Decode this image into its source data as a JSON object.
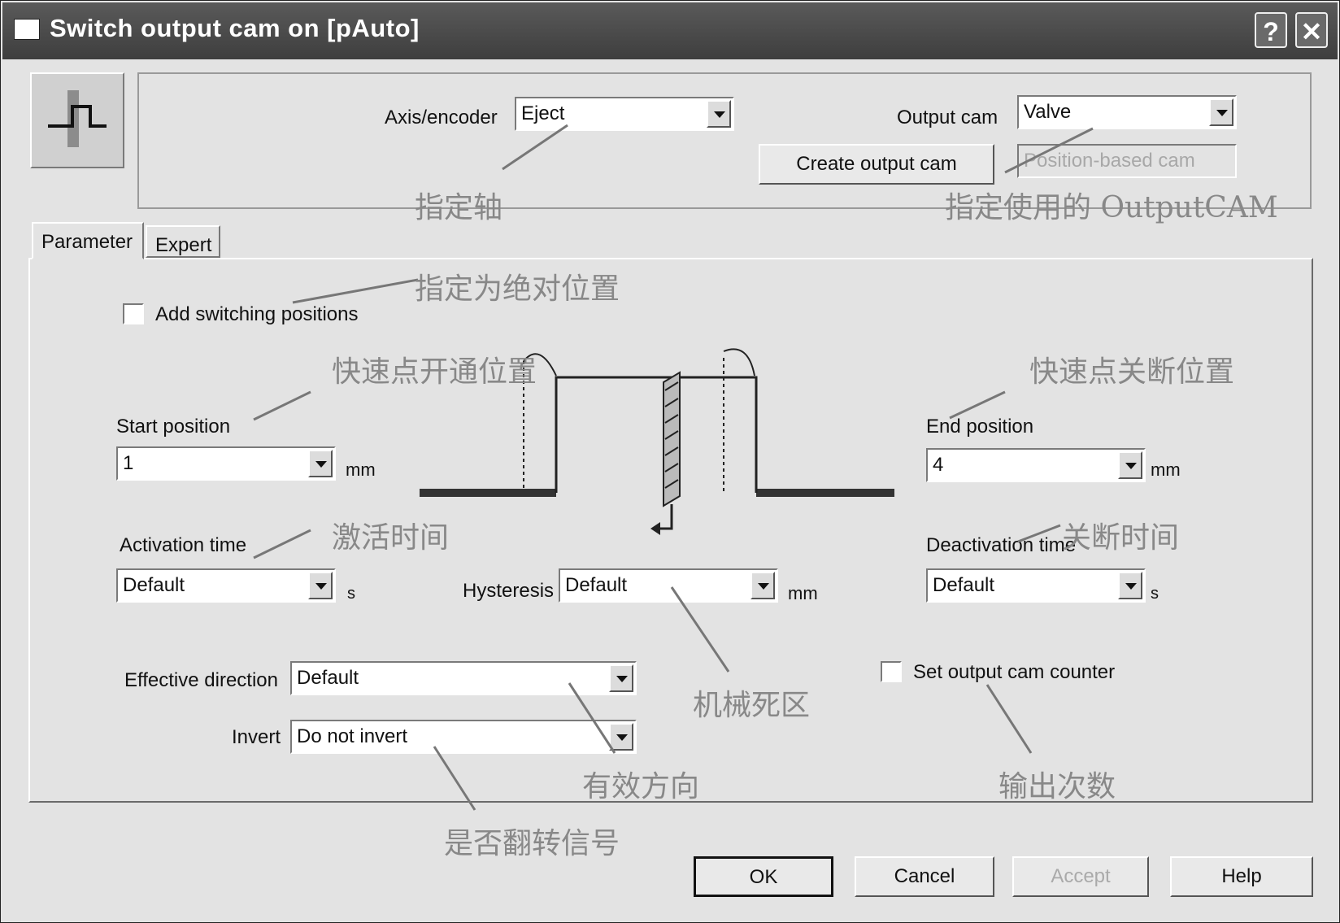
{
  "window": {
    "title": "Switch output cam on [pAuto]",
    "help_glyph": "?",
    "close_glyph": "✕"
  },
  "header": {
    "axis_label": "Axis/encoder",
    "axis_value": "Eject",
    "output_cam_label": "Output cam",
    "output_cam_value": "Valve",
    "create_button": "Create output cam",
    "cam_type": "Position-based cam"
  },
  "tabs": [
    {
      "label": "Parameter",
      "active": true
    },
    {
      "label": "Expert",
      "active": false
    }
  ],
  "parameters": {
    "add_switching_label": "Add switching positions",
    "add_switching_checked": false,
    "start_position_label": "Start position",
    "start_position_value": "1",
    "start_unit": "mm",
    "end_position_label": "End position",
    "end_position_value": "4",
    "end_unit": "mm",
    "activation_time_label": "Activation time",
    "activation_time_value": "Default",
    "activation_unit": "s",
    "hysteresis_label": "Hysteresis",
    "hysteresis_value": "Default",
    "hysteresis_unit": "mm",
    "deactivation_time_label": "Deactivation time",
    "deactivation_time_value": "Default",
    "deactivation_unit": "s",
    "effective_direction_label": "Effective direction",
    "effective_direction_value": "Default",
    "invert_label": "Invert",
    "invert_value": "Do not invert",
    "set_counter_label": "Set output cam counter",
    "set_counter_checked": false
  },
  "buttons": {
    "ok": "OK",
    "cancel": "Cancel",
    "accept": "Accept",
    "help": "Help"
  },
  "annotations": {
    "axis": "指定轴",
    "output_cam": "指定使用的 OutputCAM",
    "absolute": "指定为绝对位置",
    "start": "快速点开通位置",
    "end": "快速点关断位置",
    "activation": "激活时间",
    "deactivation": "关断时间",
    "hysteresis": "机械死区",
    "direction": "有效方向",
    "invert": "是否翻转信号",
    "counter": "输出次数"
  }
}
